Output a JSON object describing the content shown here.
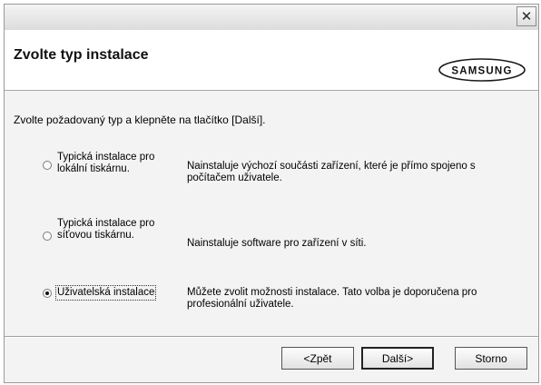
{
  "titlebar": {
    "close_glyph": "✕",
    "close_icon": "close-icon"
  },
  "header": {
    "title": "Zvolte typ instalace",
    "logo_text": "SAMSUNG"
  },
  "instruction": "Zvolte požadovaný typ a klepněte na tlačítko [Další].",
  "options": [
    {
      "label": "Typická instalace pro lokální tiskárnu.",
      "description": "Nainstaluje výchozí součásti zařízení, které je přímo spojeno s počítačem uživatele.",
      "selected": false
    },
    {
      "label": "Typická instalace pro síťovou tiskárnu.",
      "description": "Nainstaluje software pro zařízení v síti.",
      "selected": false
    },
    {
      "label": "Uživatelská instalace",
      "description": "Můžete zvolit možnosti instalace. Tato volba je doporučena pro profesionální uživatele.",
      "selected": true
    }
  ],
  "buttons": {
    "back": "<Zpět",
    "next": "Další>",
    "cancel": "Storno"
  }
}
